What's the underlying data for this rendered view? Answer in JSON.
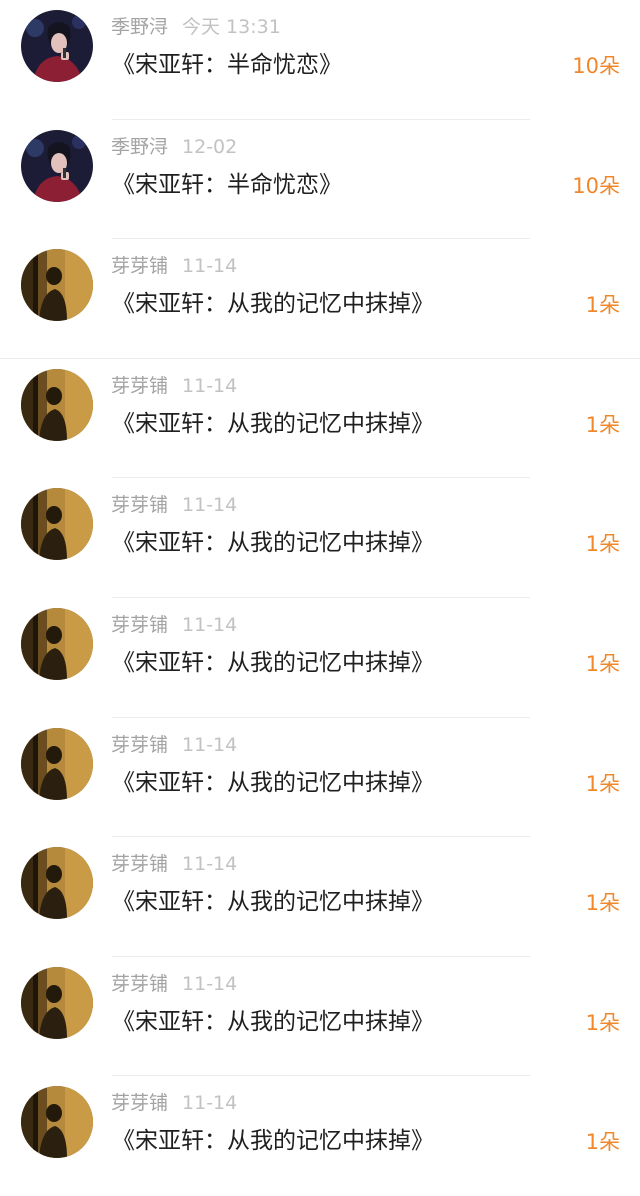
{
  "items": [
    {
      "user": "季野浔",
      "time": "今天 13:31",
      "title": "《宋亚轩：半命忧恋》",
      "count": "10朵",
      "avatar": "performer-avatar"
    },
    {
      "user": "季野浔",
      "time": "12-02",
      "title": "《宋亚轩：半命忧恋》",
      "count": "10朵",
      "avatar": "performer-avatar"
    },
    {
      "user": "芽芽铺",
      "time": "11-14",
      "title": "《宋亚轩：从我的记忆中抹掉》",
      "count": "1朵",
      "avatar": "silhouette-avatar"
    },
    {
      "user": "芽芽铺",
      "time": "11-14",
      "title": "《宋亚轩：从我的记忆中抹掉》",
      "count": "1朵",
      "avatar": "silhouette-avatar"
    },
    {
      "user": "芽芽铺",
      "time": "11-14",
      "title": "《宋亚轩：从我的记忆中抹掉》",
      "count": "1朵",
      "avatar": "silhouette-avatar"
    },
    {
      "user": "芽芽铺",
      "time": "11-14",
      "title": "《宋亚轩：从我的记忆中抹掉》",
      "count": "1朵",
      "avatar": "silhouette-avatar"
    },
    {
      "user": "芽芽铺",
      "time": "11-14",
      "title": "《宋亚轩：从我的记忆中抹掉》",
      "count": "1朵",
      "avatar": "silhouette-avatar"
    },
    {
      "user": "芽芽铺",
      "time": "11-14",
      "title": "《宋亚轩：从我的记忆中抹掉》",
      "count": "1朵",
      "avatar": "silhouette-avatar"
    },
    {
      "user": "芽芽铺",
      "time": "11-14",
      "title": "《宋亚轩：从我的记忆中抹掉》",
      "count": "1朵",
      "avatar": "silhouette-avatar"
    },
    {
      "user": "芽芽铺",
      "time": "11-14",
      "title": "《宋亚轩：从我的记忆中抹掉》",
      "count": "1朵",
      "avatar": "silhouette-avatar"
    }
  ],
  "colors": {
    "count": "#f0882b",
    "name": "#a3a3a3",
    "time": "#c2c2c2",
    "title": "#1f1f1f"
  }
}
